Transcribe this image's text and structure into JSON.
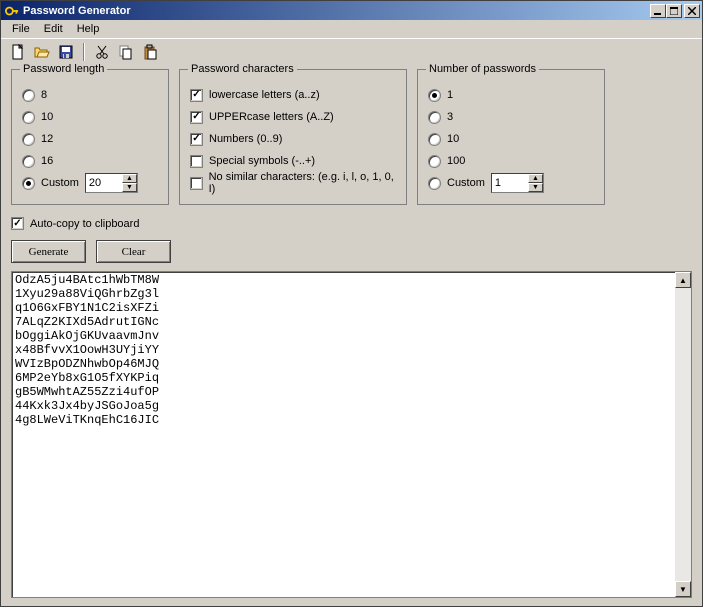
{
  "window": {
    "title": "Password Generator"
  },
  "menu": {
    "file": "File",
    "edit": "Edit",
    "help": "Help"
  },
  "groups": {
    "length": {
      "legend": "Password length",
      "opt8": "8",
      "opt10": "10",
      "opt12": "12",
      "opt16": "16",
      "custom": "Custom",
      "customValue": "20",
      "selected": "Custom"
    },
    "chars": {
      "legend": "Password characters",
      "lower": "lowercase letters (a..z)",
      "upper": "UPPERcase letters (A..Z)",
      "numbers": "Numbers (0..9)",
      "symbols": "Special symbols (-..+)",
      "nosimilar": "No similar characters: (e.g. i, l, o, 1, 0, I)",
      "lowerChecked": true,
      "upperChecked": true,
      "numbersChecked": true,
      "symbolsChecked": false,
      "nosimilarChecked": false
    },
    "count": {
      "legend": "Number of passwords",
      "opt1": "1",
      "opt3": "3",
      "opt10": "10",
      "opt100": "100",
      "custom": "Custom",
      "customValue": "1",
      "selected": "1"
    }
  },
  "autocopy": {
    "label": "Auto-copy to clipboard",
    "checked": true
  },
  "buttons": {
    "generate": "Generate",
    "clear": "Clear"
  },
  "output": "OdzA5ju4BAtc1hWbTM8W\n1Xyu29a88ViQGhrbZg3l\nq1O6GxFBY1N1C2isXFZi\n7ALqZ2KIXd5AdrutIGNc\nbOggiAkOjGKUvaavmJnv\nx48BfvvX1OowH3UYjiYY\nWVIzBpODZNhwbOp46MJQ\n6MP2eYb8xG1O5fXYKPiq\ngB5WMwhtAZ55Zzi4ufOP\n44Kxk3Jx4byJSGoJoa5g\n4g8LWeViTKnqEhC16JIC"
}
